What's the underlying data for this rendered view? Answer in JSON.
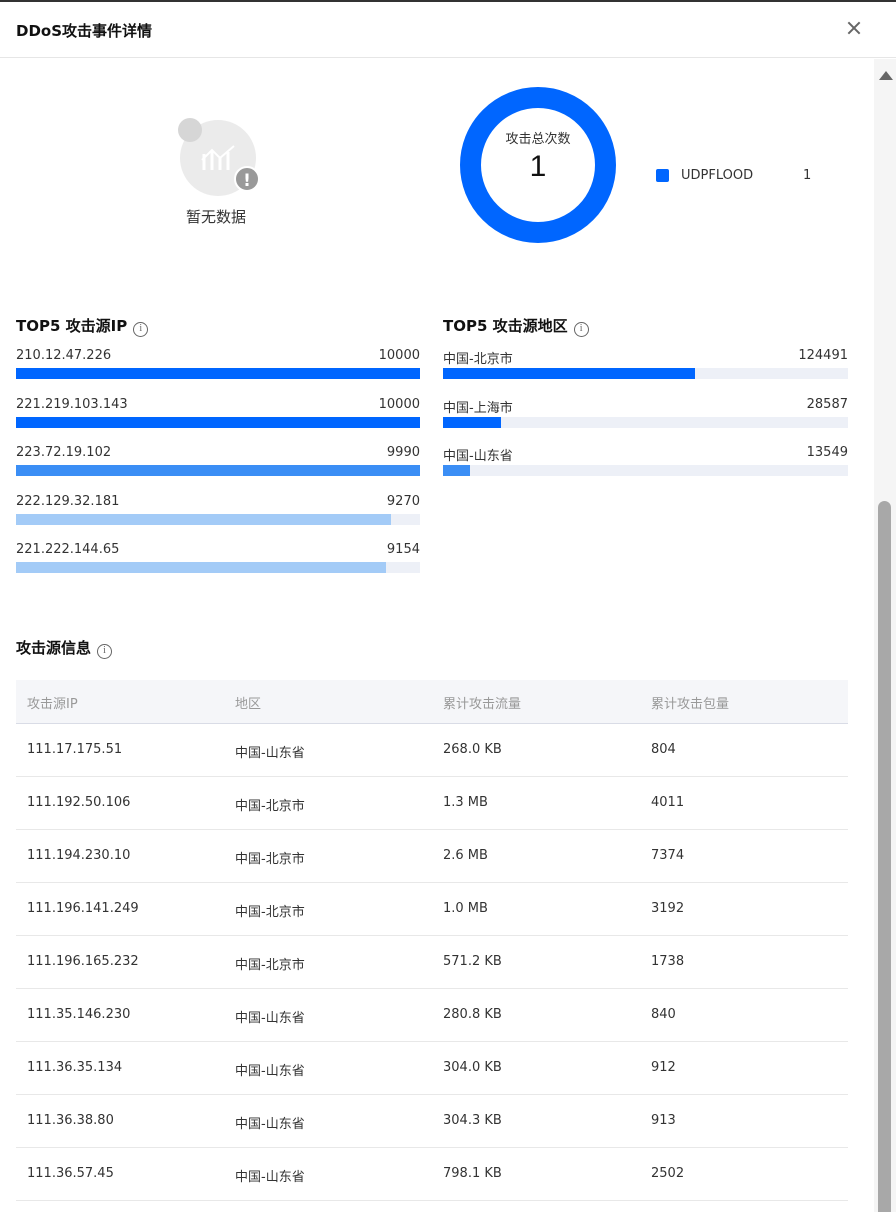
{
  "header": {
    "title": "DDoS攻击事件详情"
  },
  "nodata": {
    "text": "暂无数据"
  },
  "donut": {
    "label": "攻击总次数",
    "value": "1",
    "color": "#0066ff"
  },
  "legend": {
    "name": "UDPFLOOD",
    "count": "1"
  },
  "top5_ip": {
    "title": "TOP5 攻击源IP",
    "items": [
      {
        "name": "210.12.47.226",
        "value": 10000,
        "display": "10000",
        "color": "#0066ff"
      },
      {
        "name": "221.219.103.143",
        "value": 10000,
        "display": "10000",
        "color": "#0066ff"
      },
      {
        "name": "223.72.19.102",
        "value": 9990,
        "display": "9990",
        "color": "#3b8ef5"
      },
      {
        "name": "222.129.32.181",
        "value": 9270,
        "display": "9270",
        "color": "#a3cbf7"
      },
      {
        "name": "221.222.144.65",
        "value": 9154,
        "display": "9154",
        "color": "#a3cbf7"
      }
    ],
    "max": 10000
  },
  "top5_region": {
    "title": "TOP5 攻击源地区",
    "items": [
      {
        "name": "中国-北京市",
        "value": 124491,
        "display": "124491",
        "color": "#0066ff"
      },
      {
        "name": "中国-上海市",
        "value": 28587,
        "display": "28587",
        "color": "#0066ff"
      },
      {
        "name": "中国-山东省",
        "value": 13549,
        "display": "13549",
        "color": "#3b8ef5"
      }
    ],
    "max": 200000
  },
  "source_info": {
    "title": "攻击源信息",
    "columns": [
      "攻击源IP",
      "地区",
      "累计攻击流量",
      "累计攻击包量"
    ],
    "rows": [
      [
        "111.17.175.51",
        "中国-山东省",
        "268.0 KB",
        "804"
      ],
      [
        "111.192.50.106",
        "中国-北京市",
        "1.3 MB",
        "4011"
      ],
      [
        "111.194.230.10",
        "中国-北京市",
        "2.6 MB",
        "7374"
      ],
      [
        "111.196.141.249",
        "中国-北京市",
        "1.0 MB",
        "3192"
      ],
      [
        "111.196.165.232",
        "中国-北京市",
        "571.2 KB",
        "1738"
      ],
      [
        "111.35.146.230",
        "中国-山东省",
        "280.8 KB",
        "840"
      ],
      [
        "111.36.35.134",
        "中国-山东省",
        "304.0 KB",
        "912"
      ],
      [
        "111.36.38.80",
        "中国-山东省",
        "304.3 KB",
        "913"
      ],
      [
        "111.36.57.45",
        "中国-山东省",
        "798.1 KB",
        "2502"
      ]
    ]
  }
}
